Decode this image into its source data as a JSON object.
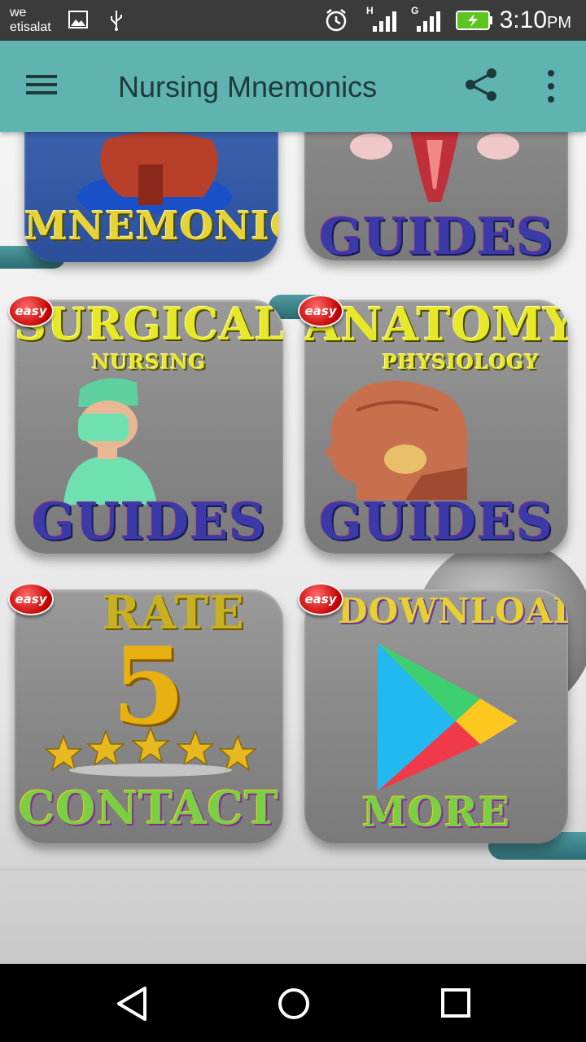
{
  "status_bar": {
    "carrier_line1": "we",
    "carrier_line2": "etisalat",
    "network1": "H",
    "network2": "G",
    "time": "3:10",
    "ampm": "PM"
  },
  "app_bar": {
    "title": "Nursing Mnemonics",
    "icons": [
      "menu-icon",
      "share-icon",
      "more-vert-icon"
    ]
  },
  "tiles": [
    {
      "name": "mnemonics",
      "bottom_text": "MNEMONICS",
      "icon": "heart-icon"
    },
    {
      "name": "guides-top",
      "bottom_text": "GUIDES",
      "icon": "uterus-icon"
    },
    {
      "name": "surgical-nursing",
      "badge": "easy",
      "title": "SURGICAL",
      "subtitle": "NURSING",
      "bottom_text": "GUIDES",
      "icon": "surgeon-icon"
    },
    {
      "name": "anatomy-physiology",
      "badge": "easy",
      "title": "ANATOMY",
      "subtitle": "PHYSIOLOGY",
      "bottom_text": "GUIDES",
      "icon": "head-anatomy-icon"
    },
    {
      "name": "rate-contact",
      "badge": "easy",
      "title": "RATE",
      "number": "5",
      "bottom_text": "CONTACT",
      "icon": "five-stars-icon"
    },
    {
      "name": "download-more-apps",
      "badge": "easy",
      "title": "DOWNLOAD",
      "bottom_text": "MORE APPS",
      "icon": "play-store-icon"
    }
  ],
  "nav_bar": {
    "icons": [
      "back-icon",
      "home-icon",
      "recents-icon"
    ]
  }
}
